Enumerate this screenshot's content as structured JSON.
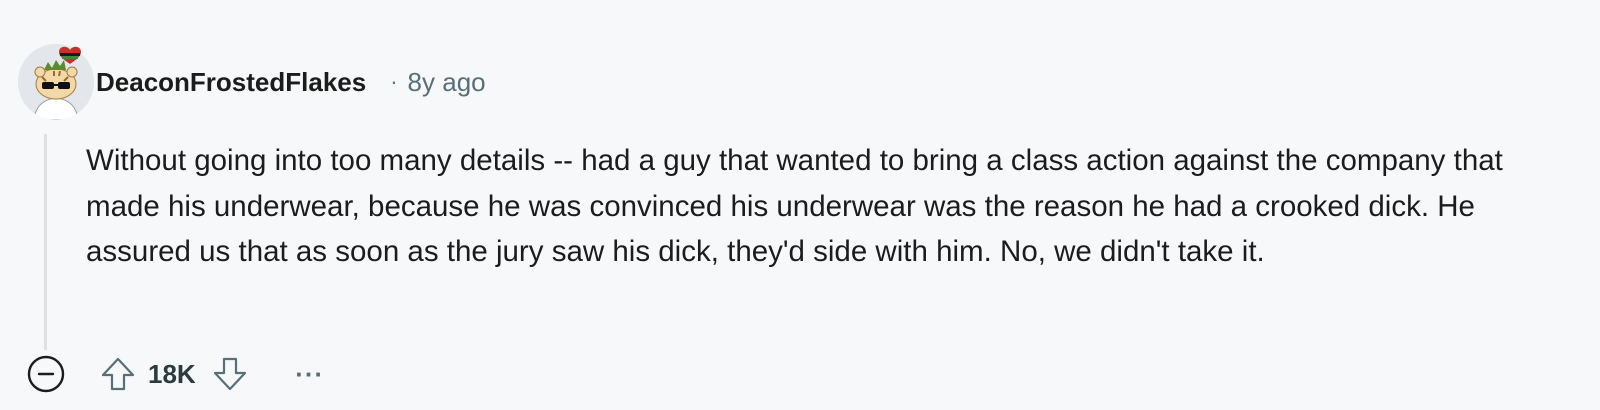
{
  "comment": {
    "author": "DeaconFrostedFlakes",
    "separator": "·",
    "age": "8y ago",
    "body": "Without going into too many details -- had a guy that wanted to bring a class action against the company that made his underwear, because he was convinced his underwear was the reason he had a crooked dick. He assured us that as soon as the jury saw his dick, they'd side with him. No, we didn't take it.",
    "actions": {
      "collapse_icon": "minus-circle-icon",
      "upvote_icon": "arrow-up-icon",
      "score": "18K",
      "downvote_icon": "arrow-down-icon",
      "more_label": "···"
    }
  },
  "colors": {
    "background": "#f7f8fa",
    "text": "#1c1c1c",
    "meta": "#576f76",
    "thread_line": "#dde1e4"
  }
}
